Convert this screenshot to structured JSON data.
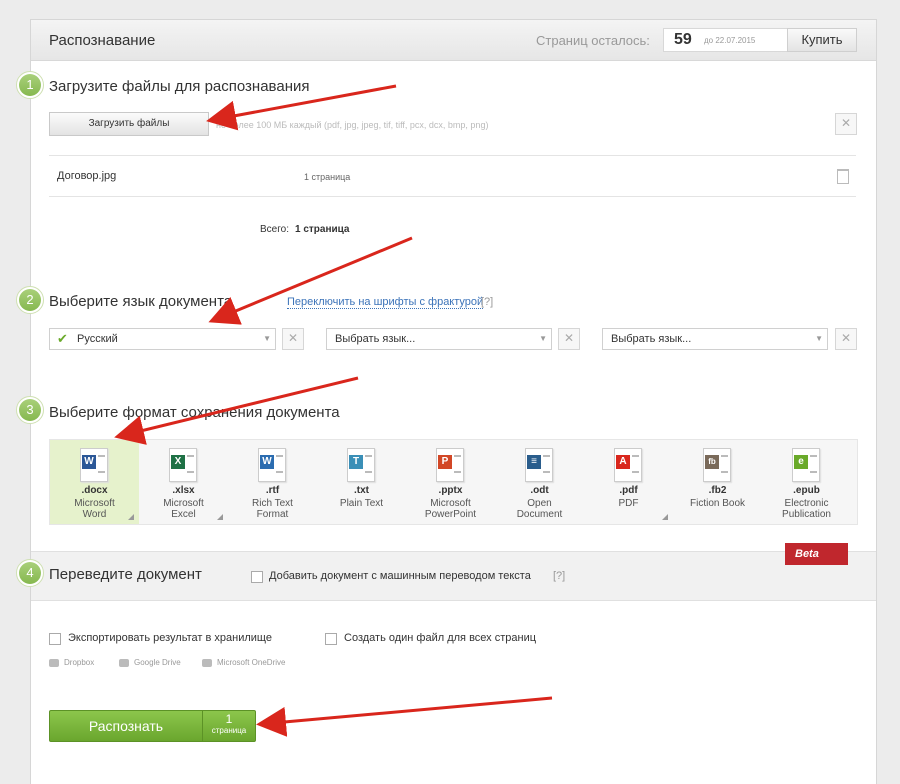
{
  "header": {
    "title": "Распознавание",
    "pages_left_label": "Страниц осталось:",
    "pages_left_count": "59",
    "valid_until": "до 22.07.2015",
    "buy_label": "Купить"
  },
  "step1": {
    "number": "1",
    "title": "Загрузите файлы для распознавания",
    "upload_button": "Загрузить файлы",
    "hint": "не более 100 МБ каждый (pdf, jpg, jpeg, tif, tiff, pcx, dcx, bmp, png)",
    "file": {
      "name": "Договор.jpg",
      "pages": "1 страница"
    },
    "total_label": "Всего:",
    "total_value": "1 страница"
  },
  "step2": {
    "number": "2",
    "title": "Выберите язык документа",
    "fraktur_link": "Переключить на шрифты с фрактурой",
    "help": "[?]",
    "languages": [
      "Русский",
      "Выбрать язык...",
      "Выбрать язык..."
    ]
  },
  "step3": {
    "number": "3",
    "title": "Выберите формат сохранения документа",
    "formats": [
      {
        "ext": ".docx",
        "desc1": "Microsoft",
        "desc2": "Word",
        "badge": "W",
        "color": "#2b5797"
      },
      {
        "ext": ".xlsx",
        "desc1": "Microsoft",
        "desc2": "Excel",
        "badge": "X",
        "color": "#1e7145"
      },
      {
        "ext": ".rtf",
        "desc1": "Rich Text",
        "desc2": "Format",
        "badge": "W",
        "color": "#2b6cb0"
      },
      {
        "ext": ".txt",
        "desc1": "Plain Text",
        "desc2": "",
        "badge": "T",
        "color": "#3a8fb7"
      },
      {
        "ext": ".pptx",
        "desc1": "Microsoft",
        "desc2": "PowerPoint",
        "badge": "P",
        "color": "#d24726"
      },
      {
        "ext": ".odt",
        "desc1": "Open",
        "desc2": "Document",
        "badge": "≡",
        "color": "#2a5d8c"
      },
      {
        "ext": ".pdf",
        "desc1": "PDF",
        "desc2": "",
        "badge": "A",
        "color": "#d9261c"
      },
      {
        "ext": ".fb2",
        "desc1": "Fiction Book",
        "desc2": "",
        "badge": "fb",
        "color": "#7a6a5a"
      },
      {
        "ext": ".epub",
        "desc1": "Electronic",
        "desc2": "Publication",
        "badge": "e",
        "color": "#6aaa2a"
      }
    ]
  },
  "step4": {
    "number": "4",
    "title": "Переведите документ",
    "translate_checkbox": "Добавить документ с машинным переводом текста",
    "help": "[?]",
    "beta": "Beta"
  },
  "options": {
    "export_storage": "Экспортировать результат в хранилище",
    "single_file": "Создать один файл для всех страниц",
    "storages": [
      "Dropbox",
      "Google Drive",
      "Microsoft OneDrive"
    ]
  },
  "recognize": {
    "label": "Распознать",
    "count": "1",
    "count_unit": "страница"
  },
  "colors": {
    "accent_green": "#7ab83e",
    "link_blue": "#3b73b9",
    "beta_red": "#c0272d",
    "arrow_red": "#d9261c"
  }
}
